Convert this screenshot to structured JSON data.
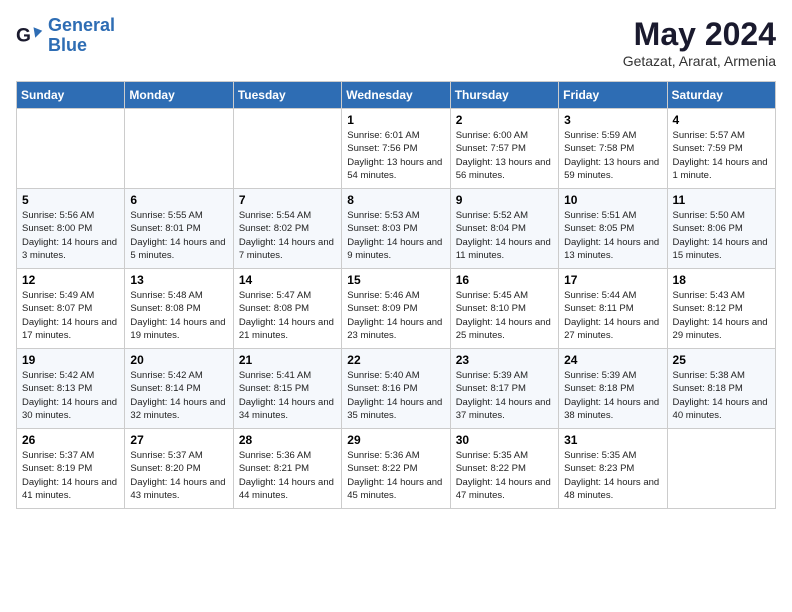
{
  "logo": {
    "line1": "General",
    "line2": "Blue"
  },
  "title": "May 2024",
  "subtitle": "Getazat, Ararat, Armenia",
  "weekdays": [
    "Sunday",
    "Monday",
    "Tuesday",
    "Wednesday",
    "Thursday",
    "Friday",
    "Saturday"
  ],
  "weeks": [
    [
      {
        "day": null
      },
      {
        "day": null
      },
      {
        "day": null
      },
      {
        "day": "1",
        "sunrise": "Sunrise: 6:01 AM",
        "sunset": "Sunset: 7:56 PM",
        "daylight": "Daylight: 13 hours and 54 minutes."
      },
      {
        "day": "2",
        "sunrise": "Sunrise: 6:00 AM",
        "sunset": "Sunset: 7:57 PM",
        "daylight": "Daylight: 13 hours and 56 minutes."
      },
      {
        "day": "3",
        "sunrise": "Sunrise: 5:59 AM",
        "sunset": "Sunset: 7:58 PM",
        "daylight": "Daylight: 13 hours and 59 minutes."
      },
      {
        "day": "4",
        "sunrise": "Sunrise: 5:57 AM",
        "sunset": "Sunset: 7:59 PM",
        "daylight": "Daylight: 14 hours and 1 minute."
      }
    ],
    [
      {
        "day": "5",
        "sunrise": "Sunrise: 5:56 AM",
        "sunset": "Sunset: 8:00 PM",
        "daylight": "Daylight: 14 hours and 3 minutes."
      },
      {
        "day": "6",
        "sunrise": "Sunrise: 5:55 AM",
        "sunset": "Sunset: 8:01 PM",
        "daylight": "Daylight: 14 hours and 5 minutes."
      },
      {
        "day": "7",
        "sunrise": "Sunrise: 5:54 AM",
        "sunset": "Sunset: 8:02 PM",
        "daylight": "Daylight: 14 hours and 7 minutes."
      },
      {
        "day": "8",
        "sunrise": "Sunrise: 5:53 AM",
        "sunset": "Sunset: 8:03 PM",
        "daylight": "Daylight: 14 hours and 9 minutes."
      },
      {
        "day": "9",
        "sunrise": "Sunrise: 5:52 AM",
        "sunset": "Sunset: 8:04 PM",
        "daylight": "Daylight: 14 hours and 11 minutes."
      },
      {
        "day": "10",
        "sunrise": "Sunrise: 5:51 AM",
        "sunset": "Sunset: 8:05 PM",
        "daylight": "Daylight: 14 hours and 13 minutes."
      },
      {
        "day": "11",
        "sunrise": "Sunrise: 5:50 AM",
        "sunset": "Sunset: 8:06 PM",
        "daylight": "Daylight: 14 hours and 15 minutes."
      }
    ],
    [
      {
        "day": "12",
        "sunrise": "Sunrise: 5:49 AM",
        "sunset": "Sunset: 8:07 PM",
        "daylight": "Daylight: 14 hours and 17 minutes."
      },
      {
        "day": "13",
        "sunrise": "Sunrise: 5:48 AM",
        "sunset": "Sunset: 8:08 PM",
        "daylight": "Daylight: 14 hours and 19 minutes."
      },
      {
        "day": "14",
        "sunrise": "Sunrise: 5:47 AM",
        "sunset": "Sunset: 8:08 PM",
        "daylight": "Daylight: 14 hours and 21 minutes."
      },
      {
        "day": "15",
        "sunrise": "Sunrise: 5:46 AM",
        "sunset": "Sunset: 8:09 PM",
        "daylight": "Daylight: 14 hours and 23 minutes."
      },
      {
        "day": "16",
        "sunrise": "Sunrise: 5:45 AM",
        "sunset": "Sunset: 8:10 PM",
        "daylight": "Daylight: 14 hours and 25 minutes."
      },
      {
        "day": "17",
        "sunrise": "Sunrise: 5:44 AM",
        "sunset": "Sunset: 8:11 PM",
        "daylight": "Daylight: 14 hours and 27 minutes."
      },
      {
        "day": "18",
        "sunrise": "Sunrise: 5:43 AM",
        "sunset": "Sunset: 8:12 PM",
        "daylight": "Daylight: 14 hours and 29 minutes."
      }
    ],
    [
      {
        "day": "19",
        "sunrise": "Sunrise: 5:42 AM",
        "sunset": "Sunset: 8:13 PM",
        "daylight": "Daylight: 14 hours and 30 minutes."
      },
      {
        "day": "20",
        "sunrise": "Sunrise: 5:42 AM",
        "sunset": "Sunset: 8:14 PM",
        "daylight": "Daylight: 14 hours and 32 minutes."
      },
      {
        "day": "21",
        "sunrise": "Sunrise: 5:41 AM",
        "sunset": "Sunset: 8:15 PM",
        "daylight": "Daylight: 14 hours and 34 minutes."
      },
      {
        "day": "22",
        "sunrise": "Sunrise: 5:40 AM",
        "sunset": "Sunset: 8:16 PM",
        "daylight": "Daylight: 14 hours and 35 minutes."
      },
      {
        "day": "23",
        "sunrise": "Sunrise: 5:39 AM",
        "sunset": "Sunset: 8:17 PM",
        "daylight": "Daylight: 14 hours and 37 minutes."
      },
      {
        "day": "24",
        "sunrise": "Sunrise: 5:39 AM",
        "sunset": "Sunset: 8:18 PM",
        "daylight": "Daylight: 14 hours and 38 minutes."
      },
      {
        "day": "25",
        "sunrise": "Sunrise: 5:38 AM",
        "sunset": "Sunset: 8:18 PM",
        "daylight": "Daylight: 14 hours and 40 minutes."
      }
    ],
    [
      {
        "day": "26",
        "sunrise": "Sunrise: 5:37 AM",
        "sunset": "Sunset: 8:19 PM",
        "daylight": "Daylight: 14 hours and 41 minutes."
      },
      {
        "day": "27",
        "sunrise": "Sunrise: 5:37 AM",
        "sunset": "Sunset: 8:20 PM",
        "daylight": "Daylight: 14 hours and 43 minutes."
      },
      {
        "day": "28",
        "sunrise": "Sunrise: 5:36 AM",
        "sunset": "Sunset: 8:21 PM",
        "daylight": "Daylight: 14 hours and 44 minutes."
      },
      {
        "day": "29",
        "sunrise": "Sunrise: 5:36 AM",
        "sunset": "Sunset: 8:22 PM",
        "daylight": "Daylight: 14 hours and 45 minutes."
      },
      {
        "day": "30",
        "sunrise": "Sunrise: 5:35 AM",
        "sunset": "Sunset: 8:22 PM",
        "daylight": "Daylight: 14 hours and 47 minutes."
      },
      {
        "day": "31",
        "sunrise": "Sunrise: 5:35 AM",
        "sunset": "Sunset: 8:23 PM",
        "daylight": "Daylight: 14 hours and 48 minutes."
      },
      {
        "day": null
      }
    ]
  ]
}
